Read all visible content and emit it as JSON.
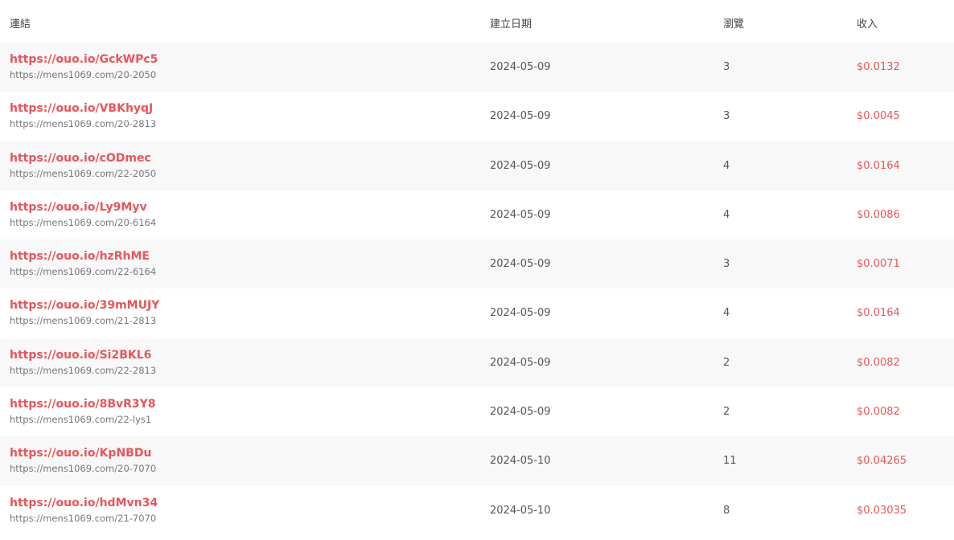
{
  "table": {
    "headers": {
      "link": "連結",
      "created": "建立日期",
      "views": "瀏覽",
      "earnings": "收入"
    },
    "rows": [
      {
        "short": "https://ouo.io/GckWPc5",
        "long": "https://mens1069.com/20-2050",
        "date": "2024-05-09",
        "views": "3",
        "earnings": "$0.0132"
      },
      {
        "short": "https://ouo.io/VBKhyqJ",
        "long": "https://mens1069.com/20-2813",
        "date": "2024-05-09",
        "views": "3",
        "earnings": "$0.0045"
      },
      {
        "short": "https://ouo.io/cODmec",
        "long": "https://mens1069.com/22-2050",
        "date": "2024-05-09",
        "views": "4",
        "earnings": "$0.0164"
      },
      {
        "short": "https://ouo.io/Ly9Myv",
        "long": "https://mens1069.com/20-6164",
        "date": "2024-05-09",
        "views": "4",
        "earnings": "$0.0086"
      },
      {
        "short": "https://ouo.io/hzRhME",
        "long": "https://mens1069.com/22-6164",
        "date": "2024-05-09",
        "views": "3",
        "earnings": "$0.0071"
      },
      {
        "short": "https://ouo.io/39mMUJY",
        "long": "https://mens1069.com/21-2813",
        "date": "2024-05-09",
        "views": "4",
        "earnings": "$0.0164"
      },
      {
        "short": "https://ouo.io/Si2BKL6",
        "long": "https://mens1069.com/22-2813",
        "date": "2024-05-09",
        "views": "2",
        "earnings": "$0.0082"
      },
      {
        "short": "https://ouo.io/8BvR3Y8",
        "long": "https://mens1069.com/22-lys1",
        "date": "2024-05-09",
        "views": "2",
        "earnings": "$0.0082"
      },
      {
        "short": "https://ouo.io/KpNBDu",
        "long": "https://mens1069.com/20-7070",
        "date": "2024-05-10",
        "views": "11",
        "earnings": "$0.04265"
      },
      {
        "short": "https://ouo.io/hdMvn34",
        "long": "https://mens1069.com/21-7070",
        "date": "2024-05-10",
        "views": "8",
        "earnings": "$0.03035"
      }
    ]
  },
  "colors": {
    "accent": "#e8555a",
    "stripe": "#f8f8f8",
    "muted": "#777777"
  }
}
